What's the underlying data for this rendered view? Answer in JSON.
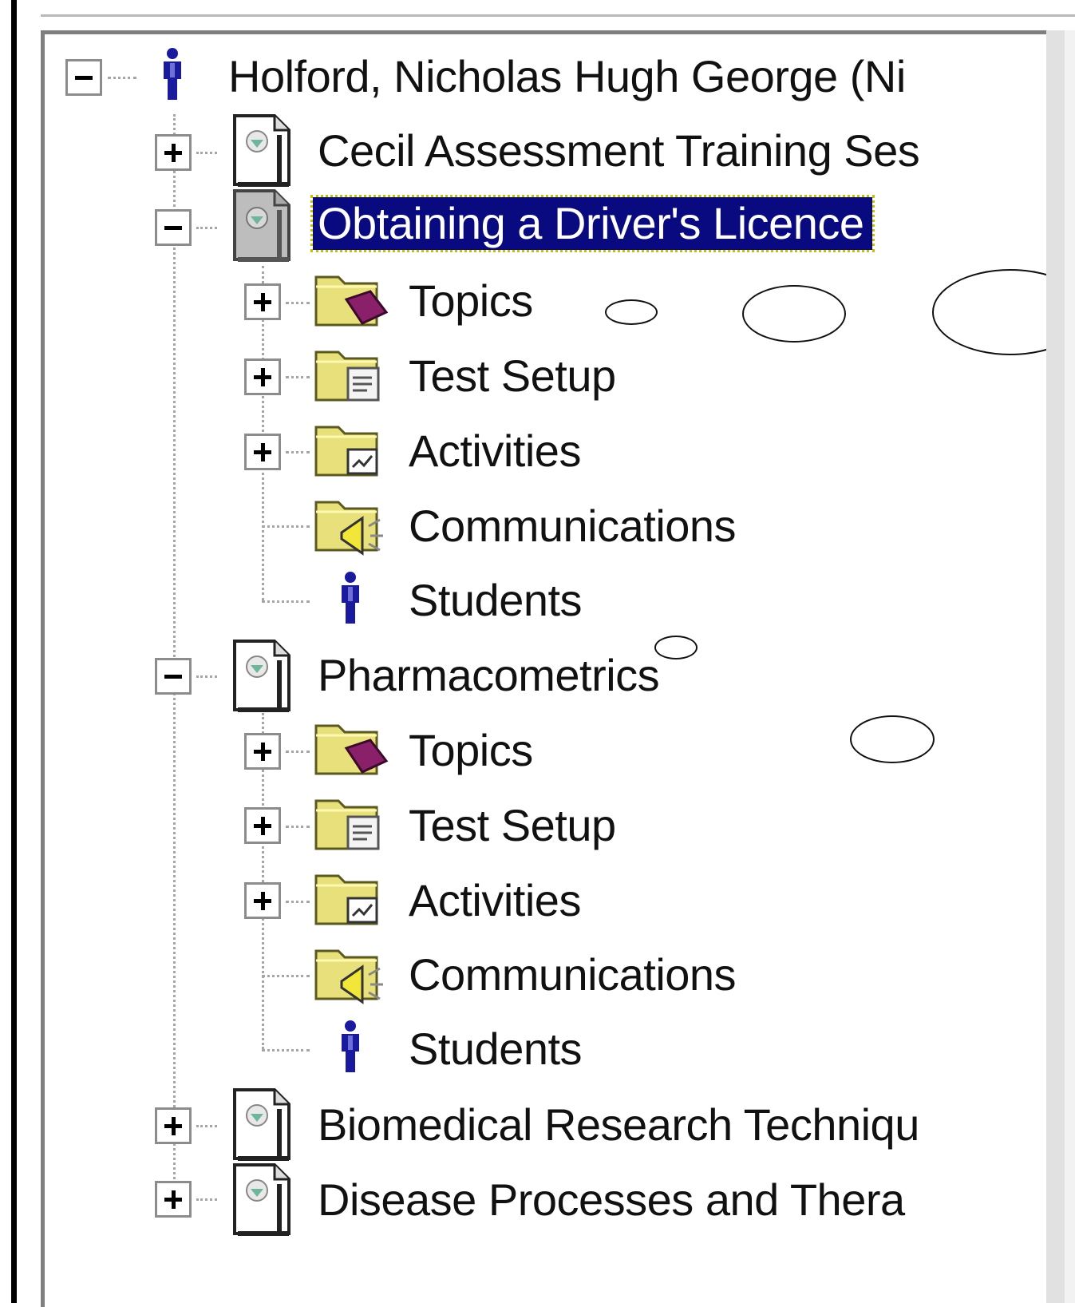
{
  "tree": {
    "root": {
      "label": "Holford, Nicholas Hugh George (Ni",
      "icon": "person-icon",
      "expanded": true
    },
    "courses": [
      {
        "label": "Cecil Assessment Training Ses",
        "icon": "document-icon",
        "expanded": false,
        "selected": false
      },
      {
        "label": "Obtaining a Driver's Licence",
        "icon": "document-icon",
        "expanded": true,
        "selected": true
      },
      {
        "label": "Pharmacometrics",
        "icon": "document-icon",
        "expanded": true,
        "selected": false
      },
      {
        "label": "Biomedical Research Techniqu",
        "icon": "document-icon",
        "expanded": false,
        "selected": false
      },
      {
        "label": "Disease Processes and Thera",
        "icon": "document-icon",
        "expanded": false,
        "selected": false
      }
    ],
    "children": [
      {
        "label": "Topics",
        "icon": "folder-book-icon",
        "expandable": true
      },
      {
        "label": "Test Setup",
        "icon": "folder-document-icon",
        "expandable": true
      },
      {
        "label": "Activities",
        "icon": "folder-chart-icon",
        "expandable": true
      },
      {
        "label": "Communications",
        "icon": "folder-megaphone-icon",
        "expandable": false
      },
      {
        "label": "Students",
        "icon": "person-icon",
        "expandable": false
      }
    ]
  },
  "colors": {
    "selection_bg": "#0a0a80",
    "selection_text": "#ffffff",
    "person_icon": "#1a1a9e",
    "folder": "#e8e07a"
  }
}
